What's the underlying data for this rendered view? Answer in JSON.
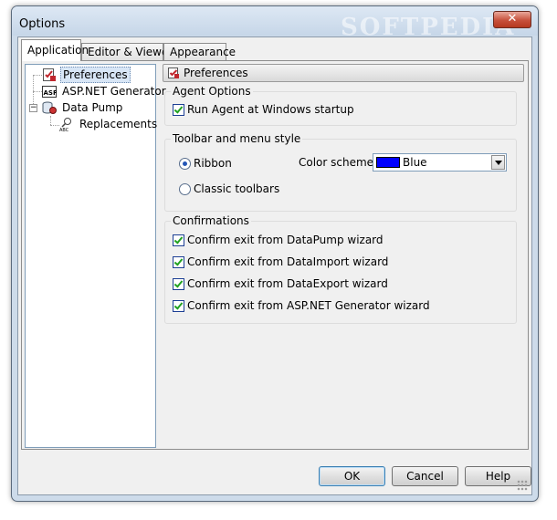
{
  "window": {
    "title": "Options",
    "close_glyph": "✕"
  },
  "watermark": "SOFTPEDIA",
  "tabs": [
    {
      "label": "Application",
      "active": true
    },
    {
      "label": "Editor & Viewers",
      "active": false
    },
    {
      "label": "Appearance",
      "active": false
    }
  ],
  "tree": [
    {
      "label": "Preferences",
      "icon": "preferences-icon",
      "selected": true
    },
    {
      "label": "ASP.NET Generator",
      "icon": "aspnet-icon",
      "selected": false
    },
    {
      "label": "Data Pump",
      "icon": "data-pump-icon",
      "selected": false,
      "expander": "−"
    },
    {
      "label": "Replacements",
      "icon": "replacements-icon",
      "selected": false
    }
  ],
  "header": {
    "title": "Preferences"
  },
  "agent_options": {
    "title": "Agent Options",
    "run_agent": {
      "label": "Run Agent at Windows startup",
      "checked": true
    }
  },
  "toolbar_style": {
    "title": "Toolbar and menu style",
    "ribbon": {
      "label": "Ribbon",
      "selected": true
    },
    "classic": {
      "label": "Classic toolbars",
      "selected": false
    },
    "color_scheme_label": "Color scheme",
    "color_scheme_value": "Blue",
    "color_scheme_swatch": "#0000ff"
  },
  "confirmations": {
    "title": "Confirmations",
    "items": [
      {
        "label": "Confirm exit from DataPump wizard",
        "checked": true
      },
      {
        "label": "Confirm exit from DataImport wizard",
        "checked": true
      },
      {
        "label": "Confirm exit from DataExport wizard",
        "checked": true
      },
      {
        "label": "Confirm exit from ASP.NET Generator wizard",
        "checked": true
      }
    ]
  },
  "buttons": {
    "ok": "OK",
    "cancel": "Cancel",
    "help": "Help"
  }
}
